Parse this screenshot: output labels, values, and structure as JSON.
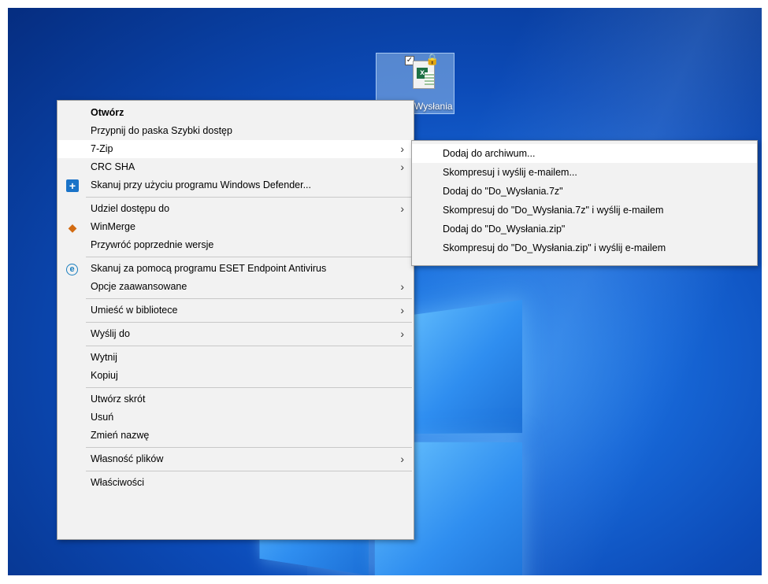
{
  "desktop": {
    "file_label": "Wysłania"
  },
  "context_menu": {
    "items": [
      {
        "label": "Otwórz"
      },
      {
        "label": "Przypnij do paska Szybki dostęp"
      },
      {
        "label": "7-Zip"
      },
      {
        "label": "CRC SHA"
      },
      {
        "label": "Skanuj przy użyciu programu Windows Defender..."
      },
      {
        "label": "Udziel dostępu do"
      },
      {
        "label": "WinMerge"
      },
      {
        "label": "Przywróć poprzednie wersje"
      },
      {
        "label": "Skanuj za pomocą programu ESET Endpoint Antivirus"
      },
      {
        "label": "Opcje zaawansowane"
      },
      {
        "label": "Umieść w bibliotece"
      },
      {
        "label": "Wyślij do"
      },
      {
        "label": "Wytnij"
      },
      {
        "label": "Kopiuj"
      },
      {
        "label": "Utwórz skrót"
      },
      {
        "label": "Usuń"
      },
      {
        "label": "Zmień nazwę"
      },
      {
        "label": "Własność plików"
      },
      {
        "label": "Właściwości"
      }
    ]
  },
  "zip_submenu": {
    "items": [
      {
        "label": "Dodaj do archiwum..."
      },
      {
        "label": "Skompresuj i wyślij e-mailem..."
      },
      {
        "label": "Dodaj do \"Do_Wysłania.7z\""
      },
      {
        "label": "Skompresuj do \"Do_Wysłania.7z\" i wyślij e-mailem"
      },
      {
        "label": "Dodaj do \"Do_Wysłania.zip\""
      },
      {
        "label": "Skompresuj do \"Do_Wysłania.zip\" i wyślij e-mailem"
      }
    ]
  },
  "glyphs": {
    "arrow": "›",
    "check": "✓",
    "lock": "🔒",
    "defender": "+",
    "winmerge": "◆",
    "eset": "e",
    "excel": "x"
  },
  "colors": {
    "desktop_blue": "#0c4bb8",
    "menu_bg": "#f2f2f2",
    "highlight": "#ffffff"
  }
}
